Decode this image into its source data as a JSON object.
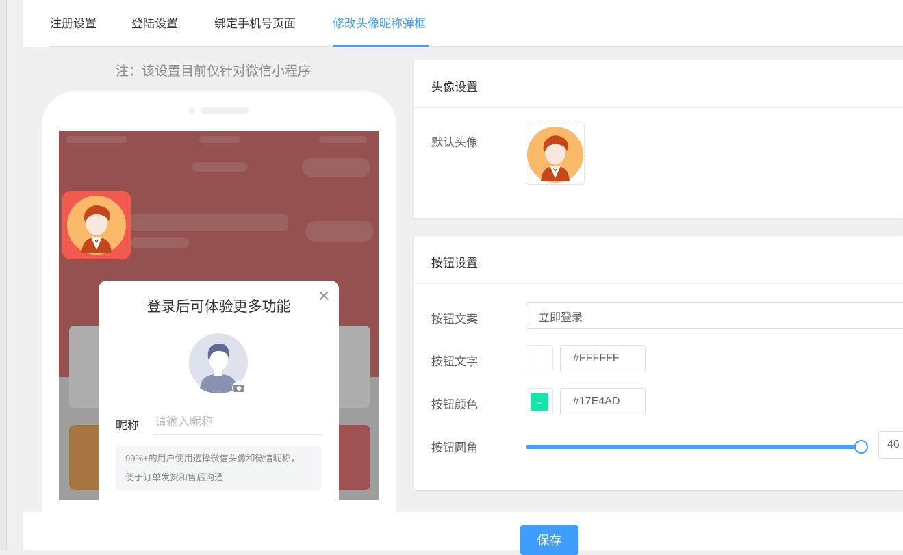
{
  "tabs": [
    {
      "label": "注册设置"
    },
    {
      "label": "登陆设置"
    },
    {
      "label": "绑定手机号页面"
    },
    {
      "label": "修改头像昵称弹框"
    }
  ],
  "active_tab": 3,
  "note": "注：该设置目前仅针对微信小程序",
  "preview": {
    "modal_title": "登录后可体验更多功能",
    "nickname_label": "昵称",
    "nickname_placeholder": "请输入昵称",
    "tip_line1": "99%+的用户使用选择微信头像和微信昵称，",
    "tip_line2": "便于订单发货和售后沟通"
  },
  "avatar_card": {
    "title": "头像设置",
    "default_avatar_label": "默认头像"
  },
  "button_card": {
    "title": "按钮设置",
    "text_label": "按钮文案",
    "text_value": "立即登录",
    "font_color_label": "按钮文字",
    "font_color_value": "#FFFFFF",
    "bg_color_label": "按钮颜色",
    "bg_color_value": "#17E4AD",
    "radius_label": "按钮圆角",
    "radius_value": "46",
    "radius_fraction": 1.0
  },
  "save_label": "保存",
  "colors": {
    "accent": "#409eff",
    "button_bg": "#17E4AD",
    "button_font": "#FFFFFF",
    "preview_red": "#c44a48"
  },
  "icons": [
    "close-icon",
    "camera-icon",
    "check-icon",
    "default-avatar-icon"
  ]
}
